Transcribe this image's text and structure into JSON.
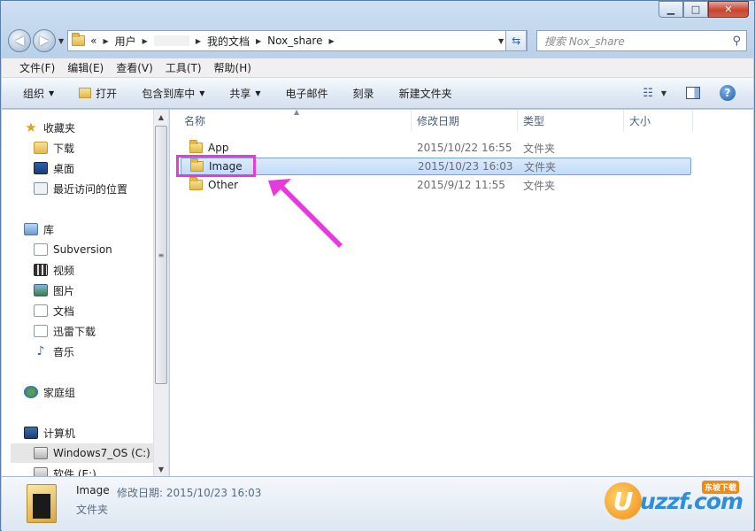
{
  "window": {
    "min_label": "▁",
    "max_label": "□",
    "close_label": "✕"
  },
  "nav": {
    "back_icon": "back-arrow-icon",
    "forward_icon": "forward-arrow-icon",
    "breadcrumb": {
      "prefix": "«",
      "items": [
        "用户",
        "我的文档",
        "Nox_share"
      ]
    },
    "search_placeholder": "搜索 Nox_share"
  },
  "menu": [
    "文件(F)",
    "编辑(E)",
    "查看(V)",
    "工具(T)",
    "帮助(H)"
  ],
  "commands": {
    "organize": "组织",
    "open": "打开",
    "include_library": "包含到库中",
    "share": "共享",
    "email": "电子邮件",
    "burn": "刻录",
    "new_folder": "新建文件夹"
  },
  "sidebar": {
    "favorites_label": "收藏夹",
    "favorites": [
      "下载",
      "桌面",
      "最近访问的位置"
    ],
    "libraries_label": "库",
    "libraries": [
      "Subversion",
      "视频",
      "图片",
      "文档",
      "迅雷下载",
      "音乐"
    ],
    "homegroup_label": "家庭组",
    "computer_label": "计算机",
    "drives": [
      "Windows7_OS (C:)",
      "软件 (E:)"
    ]
  },
  "columns": {
    "name": "名称",
    "modified": "修改日期",
    "type": "类型",
    "size": "大小"
  },
  "files": [
    {
      "name": "App",
      "modified": "2015/10/22 16:55",
      "type": "文件夹"
    },
    {
      "name": "Image",
      "modified": "2015/10/23 16:03",
      "type": "文件夹"
    },
    {
      "name": "Other",
      "modified": "2015/9/12 11:55",
      "type": "文件夹"
    }
  ],
  "details": {
    "name": "Image",
    "modified_label": "修改日期:",
    "modified": "2015/10/23 16:03",
    "type": "文件夹"
  },
  "watermark": {
    "logo_letter": "U",
    "text": "uzzf.com",
    "tag": "东坡下载"
  },
  "colors": {
    "highlight": "#e63adf",
    "selection": "#c1dbfc"
  }
}
